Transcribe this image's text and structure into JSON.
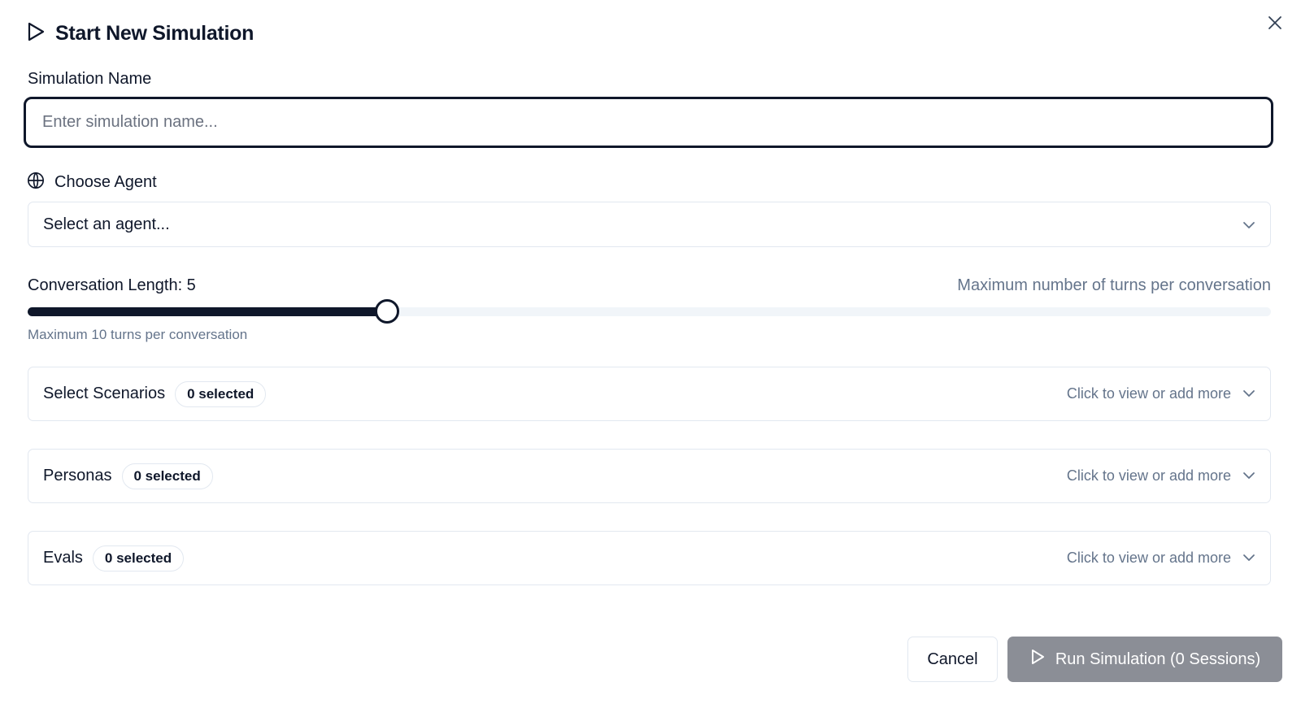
{
  "dialog": {
    "title": "Start New Simulation",
    "title_icon": "play-icon",
    "close_icon": "close-icon"
  },
  "simulation_name": {
    "label": "Simulation Name",
    "placeholder": "Enter simulation name...",
    "value": ""
  },
  "agent": {
    "label": "Choose Agent",
    "label_icon": "globe-icon",
    "selected": "Select an agent...",
    "dropdown_icon": "chevron-down-icon"
  },
  "conversation_length": {
    "label": "Conversation Length: 5",
    "help": "Maximum number of turns per conversation",
    "value": 5,
    "max": 10,
    "note": "Maximum 10 turns per conversation"
  },
  "sections": [
    {
      "title": "Select Scenarios",
      "badge": "0 selected",
      "hint": "Click to view or add more"
    },
    {
      "title": "Personas",
      "badge": "0 selected",
      "hint": "Click to view or add more"
    },
    {
      "title": "Evals",
      "badge": "0 selected",
      "hint": "Click to view or add more"
    }
  ],
  "footer": {
    "cancel_label": "Cancel",
    "run_label": "Run Simulation (0 Sessions)"
  },
  "colors": {
    "primary": "#0f172a",
    "muted_text": "#64748b",
    "border": "#e2e8f0",
    "disabled_button": "#8b8e96"
  }
}
